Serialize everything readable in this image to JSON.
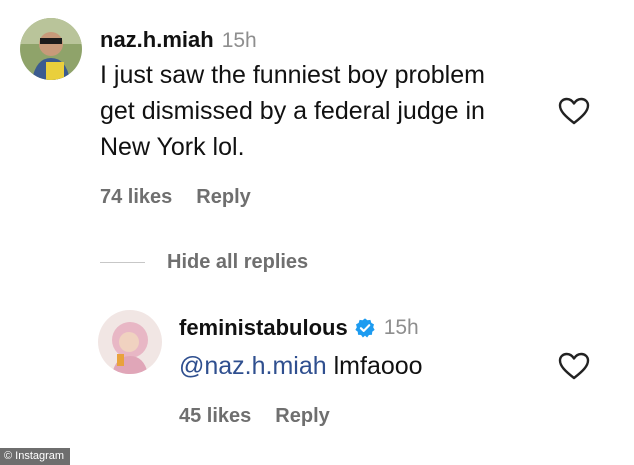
{
  "comment": {
    "username": "naz.h.miah",
    "time": "15h",
    "lines": [
      "I just saw the funniest boy problem",
      "get dismissed by a federal judge in",
      "New York lol."
    ],
    "likes": "74 likes",
    "reply": "Reply",
    "toggle_replies": "Hide all replies"
  },
  "reply_comment": {
    "username": "feministabulous",
    "time": "15h",
    "mention": "@naz.h.miah",
    "text": " lmfaooo",
    "likes": "45 likes",
    "reply": "Reply"
  },
  "watermark": "© Instagram",
  "icons": {
    "heart": "heart-outline-icon",
    "verified": "verified-badge-icon"
  },
  "colors": {
    "verified": "#1d9bf0",
    "mention": "#2f4f8f",
    "meta": "#6f6f6f"
  }
}
